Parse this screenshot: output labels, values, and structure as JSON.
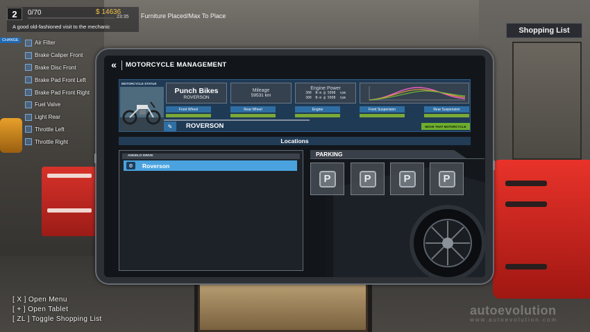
{
  "hud": {
    "level": "2",
    "xp": "0/70",
    "xp_progress": 0,
    "money": "$ 14636",
    "time": "23:35",
    "furniture_text": "Furniture Placed/Max To Place",
    "task_title": "A good old-fashioned visit to the mechanic",
    "change_label": "CHANGE",
    "tasks": [
      "Air Filter",
      "Brake Caliper Front",
      "Brake Disc Front",
      "Brake Pad Front Left",
      "Brake Pad Front Right",
      "Fuel Valve",
      "Light Rear",
      "Throttle Left",
      "Throttle Right"
    ]
  },
  "shopping_list": {
    "label": "Shopping List"
  },
  "controls": [
    "[ X ] Open Menu",
    "[ + ] Open Tablet",
    "[ ZL ] Toggle Shopping List"
  ],
  "watermark": {
    "brand": "autoevolution",
    "url": "www.autoevolution.com"
  },
  "tablet": {
    "back_icon": "double-chevron-left-icon",
    "title": "MOTORCYCLE MANAGEMENT",
    "status": {
      "label": "MOTORCYCLE STATUS",
      "brand": "Punch Bikes",
      "model": "ROVERSON",
      "mileage_label": "Mileage",
      "mileage": "59531 km",
      "engine_power_label": "Engine Power",
      "power_lines": [
        "300  N·m @ 5098  rpm",
        "300  N·m @ 5098  rpm"
      ],
      "parts": [
        {
          "label": "Front Wheel",
          "condition": 1.0
        },
        {
          "label": "Rear Wheel",
          "condition": 1.0
        },
        {
          "label": "Engine",
          "condition": 1.0
        },
        {
          "label": "Front Suspension",
          "condition": 1.0
        },
        {
          "label": "Rear Suspension",
          "condition": 1.0
        }
      ],
      "bike_name": "ROVERSON",
      "move_button": "MOVE THAT MOTORCYCLE",
      "graph_colors": [
        "#e85cc4",
        "#e8a03a",
        "#6fb83a"
      ]
    },
    "locations_label": "Locations",
    "list_header": "ANGELO DRIVE",
    "list_items": [
      "Roverson"
    ],
    "parking_label": "PARKING",
    "parking_icon": "P"
  }
}
